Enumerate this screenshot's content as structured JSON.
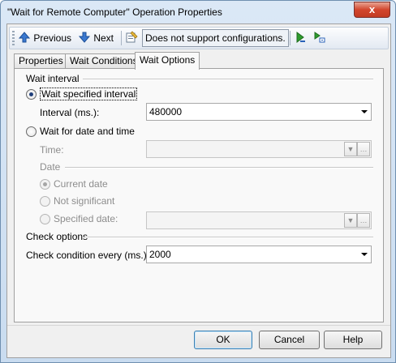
{
  "window": {
    "title": "\"Wait for Remote Computer\" Operation Properties",
    "close_glyph": "x"
  },
  "toolbar": {
    "previous_label": "Previous",
    "next_label": "Next",
    "configurations_label": "Does not support configurations."
  },
  "tabs": [
    {
      "label": "Properties"
    },
    {
      "label": "Wait Conditions"
    },
    {
      "label": "Wait Options",
      "active": true
    }
  ],
  "wait_interval": {
    "section_label": "Wait interval",
    "option_specified_interval": "Wait specified interval",
    "interval_label": "Interval (ms.):",
    "interval_value": "480000",
    "option_date_time": "Wait for date and time",
    "time_label": "Time:",
    "time_value": "",
    "date_label": "Date",
    "option_current_date": "Current date",
    "option_not_significant": "Not significant",
    "option_specified_date": "Specified date:",
    "specified_date_value": ""
  },
  "check_options": {
    "section_label": "Check options",
    "check_every_label": "Check condition every (ms.):",
    "check_every_value": "2000"
  },
  "buttons": {
    "ok": "OK",
    "cancel": "Cancel",
    "help": "Help"
  },
  "icons": {
    "previous": "arrow-up-icon",
    "next": "arrow-down-icon",
    "configurations": "configuration-icon",
    "run": "run-icon",
    "run_step": "run-step-icon"
  },
  "colors": {
    "accent": "#2a62b8",
    "run_green": "#2e9b2e"
  }
}
